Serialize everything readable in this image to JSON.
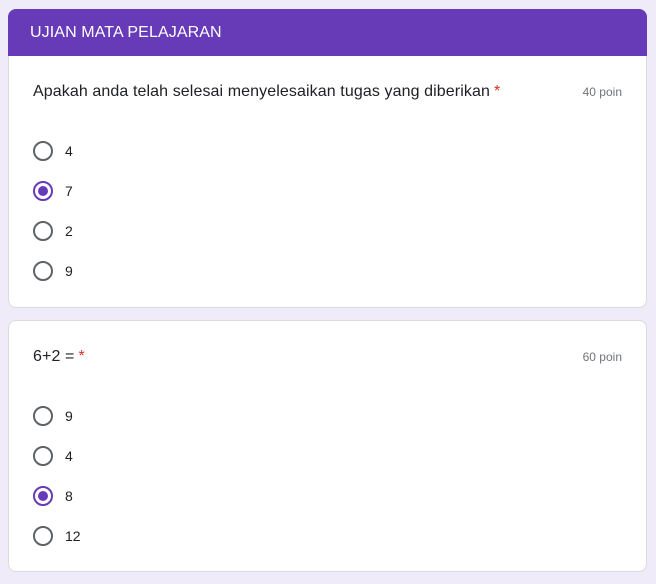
{
  "form": {
    "section_title": "UJIAN MATA PELAJARAN"
  },
  "questions": [
    {
      "text": "Apakah anda telah selesai menyelesaikan tugas yang diberikan",
      "required_mark": "*",
      "points": "40 poin",
      "options": [
        {
          "label": "4",
          "selected": false
        },
        {
          "label": "7",
          "selected": true
        },
        {
          "label": "2",
          "selected": false
        },
        {
          "label": "9",
          "selected": false
        }
      ]
    },
    {
      "text": "6+2 =",
      "required_mark": "*",
      "points": "60 poin",
      "options": [
        {
          "label": "9",
          "selected": false
        },
        {
          "label": "4",
          "selected": false
        },
        {
          "label": "8",
          "selected": true
        },
        {
          "label": "12",
          "selected": false
        }
      ]
    }
  ],
  "colors": {
    "accent": "#673ab7",
    "background": "#efebf8",
    "required": "#d93025"
  }
}
